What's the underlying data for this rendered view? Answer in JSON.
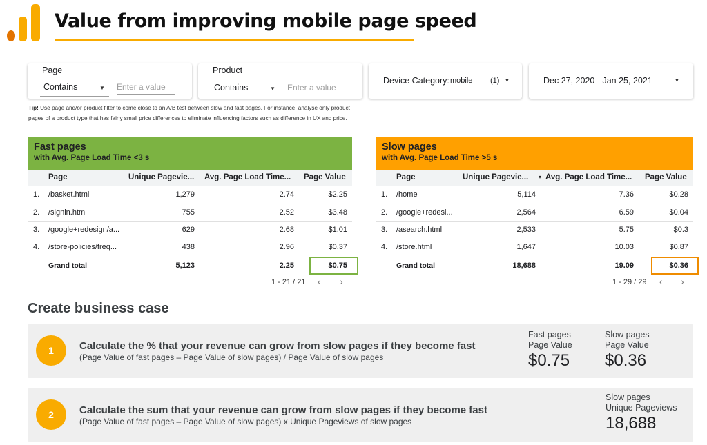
{
  "colors": {
    "accent_orange": "#f9ab00",
    "fast_green": "#7cb342",
    "slow_orange": "#ffa000",
    "logo_dark": "#e37400"
  },
  "header": {
    "title": "Value from improving mobile page speed"
  },
  "filters": {
    "page": {
      "label": "Page",
      "operator": "Contains",
      "placeholder": "Enter a value"
    },
    "product": {
      "label": "Product",
      "operator": "Contains",
      "placeholder": "Enter a value"
    },
    "device": {
      "label": "Device Category:",
      "value": "mobile",
      "count": "(1)"
    },
    "date": {
      "value": "Dec 27, 2020 - Jan 25, 2021"
    }
  },
  "tip": {
    "bold": "Tip!",
    "text": " Use page and/or product filter to come close to an A/B test between slow and fast pages. For instance, analyse only product pages of a product type that has fairly small price differences to eliminate influencing factors such as difference in UX and price."
  },
  "fast_table": {
    "title": "Fast pages",
    "subtitle": "with Avg. Page Load Time <3 s",
    "columns": [
      "Page",
      "Unique Pagevie...",
      "Avg. Page Load Time...",
      "Page Value"
    ],
    "rows": [
      {
        "num": "1.",
        "page": "/basket.html",
        "upv": "1,279",
        "load": "2.74",
        "value": "$2.25"
      },
      {
        "num": "2.",
        "page": "/signin.html",
        "upv": "755",
        "load": "2.52",
        "value": "$3.48"
      },
      {
        "num": "3.",
        "page": "/google+redesign/a...",
        "upv": "629",
        "load": "2.68",
        "value": "$1.01"
      },
      {
        "num": "4.",
        "page": "/store-policies/freq...",
        "upv": "438",
        "load": "2.96",
        "value": "$0.37"
      }
    ],
    "total": {
      "label": "Grand total",
      "upv": "5,123",
      "load": "2.25",
      "value": "$0.75"
    },
    "pager": "1 - 21 / 21"
  },
  "slow_table": {
    "title": "Slow pages",
    "subtitle": "with Avg. Page Load Time >5 s",
    "columns": [
      "Page",
      "Unique Pagevie...",
      "Avg. Page Load Time...",
      "Page Value"
    ],
    "sort_indicator": "▾",
    "rows": [
      {
        "num": "1.",
        "page": "/home",
        "upv": "5,114",
        "load": "7.36",
        "value": "$0.28"
      },
      {
        "num": "2.",
        "page": "/google+redesi...",
        "upv": "2,564",
        "load": "6.59",
        "value": "$0.04"
      },
      {
        "num": "3.",
        "page": "/asearch.html",
        "upv": "2,533",
        "load": "5.75",
        "value": "$0.3"
      },
      {
        "num": "4.",
        "page": "/store.html",
        "upv": "1,647",
        "load": "10.03",
        "value": "$0.87"
      }
    ],
    "total": {
      "label": "Grand total",
      "upv": "18,688",
      "load": "19.09",
      "value": "$0.36"
    },
    "pager": "1 - 29 / 29"
  },
  "business_case": {
    "title": "Create business case",
    "step1": {
      "num": "1",
      "heading": "Calculate the % that your revenue can grow from slow pages if they become fast",
      "formula": "(Page Value of fast pages – Page Value of slow pages) / Page Value of slow pages",
      "kpi_fast": {
        "label1": "Fast pages",
        "label2": "Page Value",
        "value": "$0.75"
      },
      "kpi_slow": {
        "label1": "Slow pages",
        "label2": "Page Value",
        "value": "$0.36"
      }
    },
    "step2": {
      "num": "2",
      "heading": "Calculate the sum that your revenue can grow from slow pages if they become fast",
      "formula": "(Page Value of fast pages – Page Value of slow pages) x Unique Pageviews of slow pages",
      "kpi_slow": {
        "label1": "Slow pages",
        "label2": "Unique Pageviews",
        "value": "18,688"
      }
    }
  }
}
